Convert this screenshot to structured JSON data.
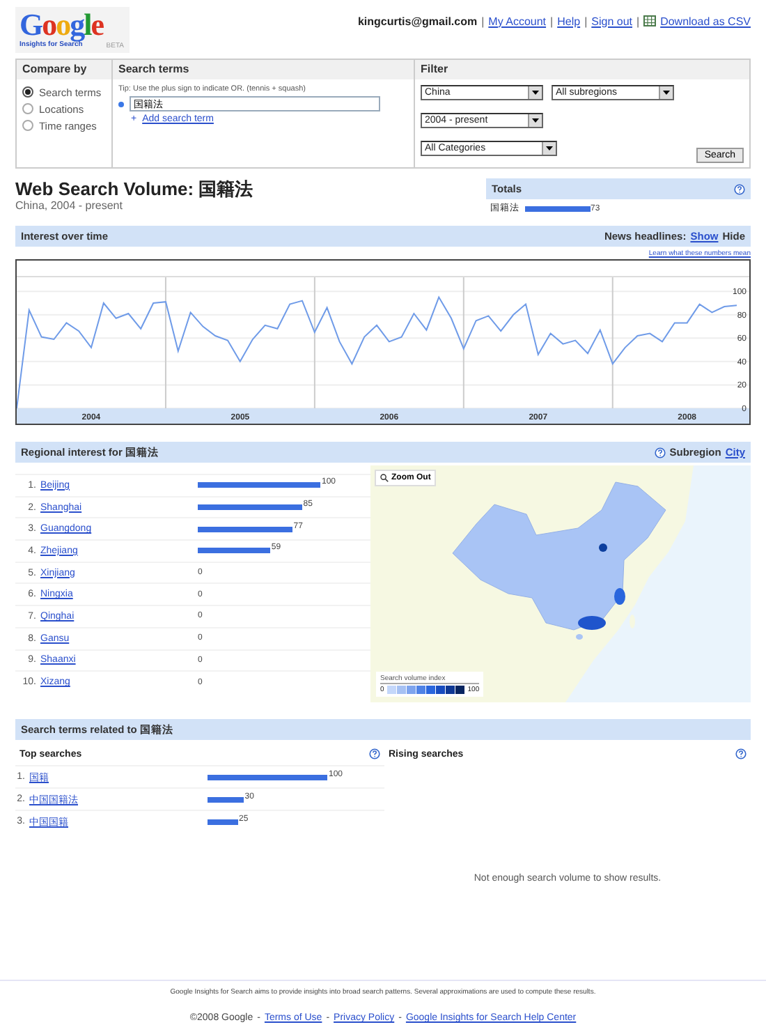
{
  "logo": {
    "name": "Google",
    "subtitle": "Insights for Search",
    "badge": "BETA"
  },
  "header": {
    "user": "kingcurtis@gmail.com",
    "separator": "|",
    "links": [
      "My Account",
      "Help",
      "Sign out"
    ],
    "csv_link": "Download as CSV"
  },
  "compare_by": {
    "title": "Compare by",
    "options": [
      {
        "label": "Search terms",
        "selected": true
      },
      {
        "label": "Locations",
        "selected": false
      },
      {
        "label": "Time ranges",
        "selected": false
      }
    ]
  },
  "search_terms": {
    "title": "Search terms",
    "tip": "Tip: Use the plus sign to indicate OR. (tennis + squash)",
    "terms": [
      "国籍法"
    ],
    "add_symbol": "+",
    "add_link": "Add search term"
  },
  "filter": {
    "title": "Filter",
    "selects": [
      "China",
      "All subregions",
      "2004 - present",
      "All Categories"
    ],
    "button": "Search"
  },
  "title": {
    "heading": "Web Search Volume: 国籍法",
    "subtitle": "China, 2004 - present"
  },
  "totals": {
    "title": "Totals",
    "rows": [
      {
        "term": "国籍法",
        "value": "73"
      }
    ]
  },
  "interest": {
    "title": "Interest over time",
    "news_label": "News headlines:",
    "show": "Show",
    "hide": "Hide",
    "learn_link": "Learn what these numbers mean",
    "chart_data": {
      "type": "line",
      "categories": [
        null,
        null,
        null,
        null,
        null,
        null,
        "2004",
        null,
        null,
        null,
        null,
        null,
        null,
        null,
        null,
        null,
        null,
        null,
        "2005",
        null,
        null,
        null,
        null,
        null,
        null,
        null,
        null,
        null,
        null,
        null,
        "2006",
        null,
        null,
        null,
        null,
        null,
        null,
        null,
        null,
        null,
        null,
        null,
        "2007",
        null,
        null,
        null,
        null,
        null,
        null,
        null,
        null,
        null,
        null,
        null,
        "2008",
        null,
        null,
        null,
        null
      ],
      "ylim": [
        0,
        112
      ],
      "grid": true,
      "yticks": [
        0,
        20,
        40,
        60,
        80,
        100
      ],
      "series": [
        {
          "color": "#6f9be8",
          "values": [
            0,
            84,
            61,
            59,
            73,
            66,
            52,
            90,
            77,
            81,
            68,
            90,
            91,
            49,
            82,
            70,
            62,
            58,
            40,
            59,
            71,
            68,
            89,
            92,
            65,
            86,
            57,
            38,
            61,
            71,
            57,
            61,
            81,
            67,
            95,
            77,
            51,
            75,
            79,
            66,
            80,
            89,
            46,
            64,
            55,
            58,
            47,
            67,
            38,
            52,
            62,
            64,
            57,
            73,
            73,
            89,
            82,
            87,
            88
          ]
        }
      ]
    }
  },
  "regional": {
    "title": "Regional interest  for 国籍法",
    "subregion_label": "Subregion",
    "subregion_link": "City",
    "rows": [
      {
        "rank": "1.",
        "name": "Beijing",
        "value": "100"
      },
      {
        "rank": "2.",
        "name": "Shanghai",
        "value": "85"
      },
      {
        "rank": "3.",
        "name": "Guangdong",
        "value": "77"
      },
      {
        "rank": "4.",
        "name": "Zhejiang",
        "value": "59"
      },
      {
        "rank": "5.",
        "name": "Xinjiang",
        "value": "0"
      },
      {
        "rank": "6.",
        "name": "Ningxia",
        "value": "0"
      },
      {
        "rank": "7.",
        "name": "Qinghai",
        "value": "0"
      },
      {
        "rank": "8.",
        "name": "Gansu",
        "value": "0"
      },
      {
        "rank": "9.",
        "name": "Shaanxi",
        "value": "0"
      },
      {
        "rank": "10.",
        "name": "Xizang",
        "value": "0"
      }
    ],
    "map": {
      "kind": "picture",
      "zoom_out": "Zoom Out",
      "legend_title": "Search volume index",
      "legend_min": "0",
      "legend_max": "100"
    }
  },
  "related": {
    "title": "Search terms related to 国籍法",
    "top_title": "Top searches",
    "rising_title": "Rising searches",
    "top": [
      {
        "rank": "1.",
        "term": "国籍",
        "value": "100"
      },
      {
        "rank": "2.",
        "term": "中国国籍法",
        "value": "30"
      },
      {
        "rank": "3.",
        "term": "中国国籍",
        "value": "25"
      }
    ],
    "rising_empty": "Not enough search volume to show results."
  },
  "footer": {
    "note": "Google Insights for Search aims to provide insights into broad search patterns. Several approximations are used to compute these results.",
    "copyright": "©2008 Google",
    "separator": "-",
    "links": [
      "Terms of Use",
      "Privacy Policy",
      "Google Insights for Search Help Center"
    ]
  }
}
